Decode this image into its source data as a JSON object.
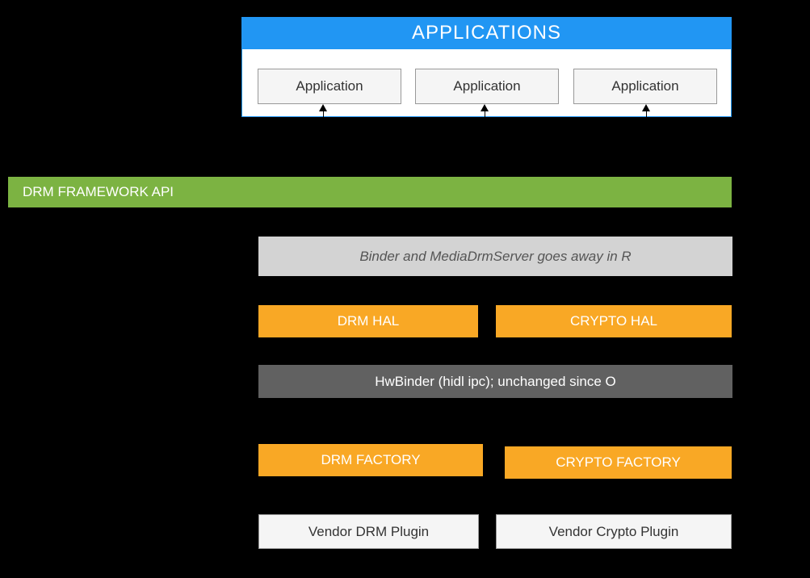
{
  "applications": {
    "header": "APPLICATIONS",
    "items": [
      "Application",
      "Application",
      "Application"
    ]
  },
  "drm_framework": "DRM FRAMEWORK API",
  "binder_note": "Binder and MediaDrmServer  goes away in R",
  "hals": {
    "drm": "DRM HAL",
    "crypto": "CRYPTO HAL"
  },
  "hwbinder": "HwBinder (hidl ipc); unchanged since O",
  "factories": {
    "drm": "DRM FACTORY",
    "crypto": "CRYPTO FACTORY"
  },
  "vendors": {
    "drm": "Vendor DRM Plugin",
    "crypto": "Vendor Crypto Plugin"
  }
}
